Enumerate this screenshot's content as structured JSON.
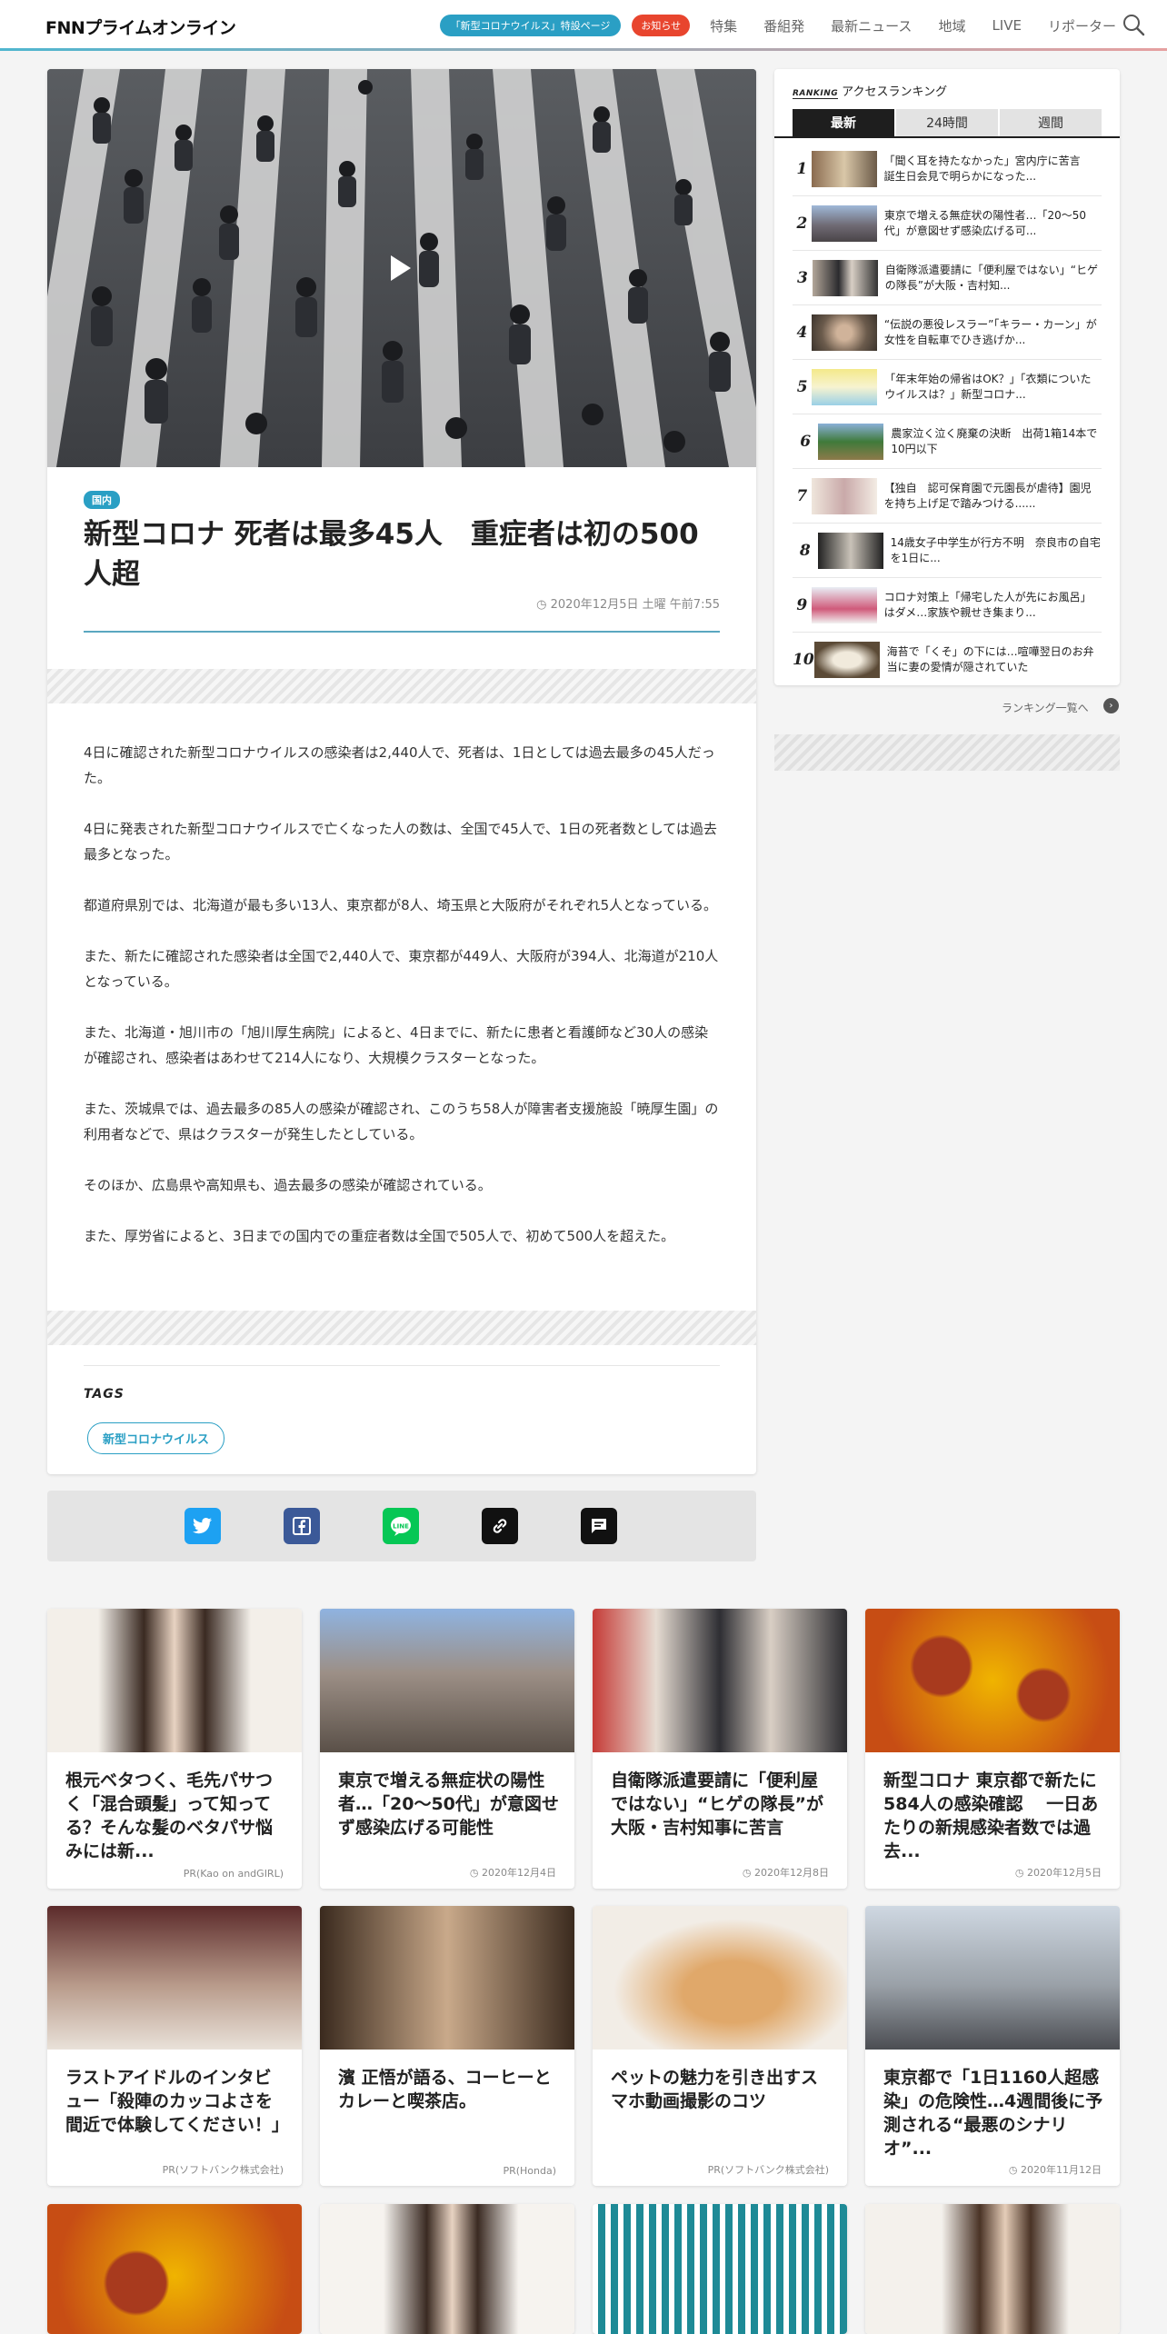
{
  "header": {
    "logo": "FNNプライムオンライン",
    "covid_pill": "「新型コロナウイルス」特設ページ",
    "notice_pill": "お知らせ",
    "nav": [
      "特集",
      "番組発",
      "最新ニュース",
      "地域",
      "LIVE",
      "リポーター"
    ]
  },
  "article": {
    "category": "国内",
    "title": "新型コロナ 死者は最多45人　重症者は初の500人超",
    "date": "2020年12月5日 土曜 午前7:55",
    "paragraphs": [
      "4日に確認された新型コロナウイルスの感染者は2,440人で、死者は、1日としては過去最多の45人だった。",
      "4日に発表された新型コロナウイルスで亡くなった人の数は、全国で45人で、1日の死者数としては過去最多となった。",
      "都道府県別では、北海道が最も多い13人、東京都が8人、埼玉県と大阪府がそれぞれ5人となっている。",
      "また、新たに確認された感染者は全国で2,440人で、東京都が449人、大阪府が394人、北海道が210人となっている。",
      "また、北海道・旭川市の「旭川厚生病院」によると、4日までに、新たに患者と看護師など30人の感染が確認され、感染者はあわせて214人になり、大規模クラスターとなった。",
      "また、茨城県では、過去最多の85人の感染が確認され、このうち58人が障害者支援施設「暁厚生園」の利用者などで、県はクラスターが発生したとしている。",
      "そのほか、広島県や高知県も、過去最多の感染が確認されている。",
      "また、厚労省によると、3日までの国内での重症者数は全国で505人で、初めて500人を超えた。"
    ],
    "tags_label": "TAGS",
    "tags": [
      "新型コロナウイルス"
    ]
  },
  "share_icons": [
    "twitter-icon",
    "facebook-icon",
    "line-icon",
    "link-icon",
    "comment-icon"
  ],
  "ranking": {
    "label_en": "RANKING",
    "label": "アクセスランキング",
    "tabs": [
      "最新",
      "24時間",
      "週間"
    ],
    "active_tab": "最新",
    "items": [
      {
        "num": "1",
        "text": "「聞く耳を持たなかった」宮内庁に苦言　誕生日会見で明らかになった..."
      },
      {
        "num": "2",
        "text": "東京で増える無症状の陽性者…「20～50代」が意図せず感染広げる可..."
      },
      {
        "num": "3",
        "text": "自衛隊派遣要請に「便利屋ではない」“ヒゲの隊長”が大阪・吉村知..."
      },
      {
        "num": "4",
        "text": "“伝説の悪役レスラー”「キラー・カーン」が女性を自転車でひき逃げか..."
      },
      {
        "num": "5",
        "text": "「年末年始の帰省はOK？」「衣類についたウイルスは？」新型コロナ..."
      },
      {
        "num": "6",
        "text": "農家泣く泣く廃棄の決断　出荷1箱14本で10円以下"
      },
      {
        "num": "7",
        "text": "【独自　認可保育園で元園長が虐待】園児を持ち上げ足で踏みつける......"
      },
      {
        "num": "8",
        "text": "14歳女子中学生が行方不明　奈良市の自宅を1日に..."
      },
      {
        "num": "9",
        "text": "コロナ対策上「帰宅した人が先にお風呂」はダメ…家族や親せき集まり..."
      },
      {
        "num": "10",
        "text": "海苔で「くそ」の下には…喧嘩翌日のお弁当に妻の愛情が隠されていた"
      }
    ],
    "more": "ランキング一覧へ"
  },
  "cards": [
    {
      "title": "根元ベタつく、毛先パサつく「混合頭髪」って知ってる？そんな髪のベタパサ悩みには新...",
      "meta": "PR(Kao on andGIRL)"
    },
    {
      "title": "東京で増える無症状の陽性者…「20～50代」が意図せず感染広げる可能性",
      "meta": "2020年12月4日"
    },
    {
      "title": "自衛隊派遣要請に「便利屋ではない」“ヒゲの隊長”が大阪・吉村知事に苦言",
      "meta": "2020年12月8日"
    },
    {
      "title": "新型コロナ 東京都で新たに584人の感染確認　 一日あたりの新規感染者数では過去...",
      "meta": "2020年12月5日"
    },
    {
      "title": "ラストアイドルのインタビュー「殺陣のカッコよさを間近で体験してください！」",
      "meta": "PR(ソフトバンク株式会社)"
    },
    {
      "title": "濱 正悟が語る、コーヒーとカレーと喫茶店。",
      "meta": "PR(Honda)"
    },
    {
      "title": "ペットの魅力を引き出すスマホ動画撮影のコツ",
      "meta": "PR(ソフトバンク株式会社)"
    },
    {
      "title": "東京都で「1日1160人超感染」の危険性…4週間後に予測される“最悪のシナリオ”...",
      "meta": "2020年11月12日"
    }
  ]
}
